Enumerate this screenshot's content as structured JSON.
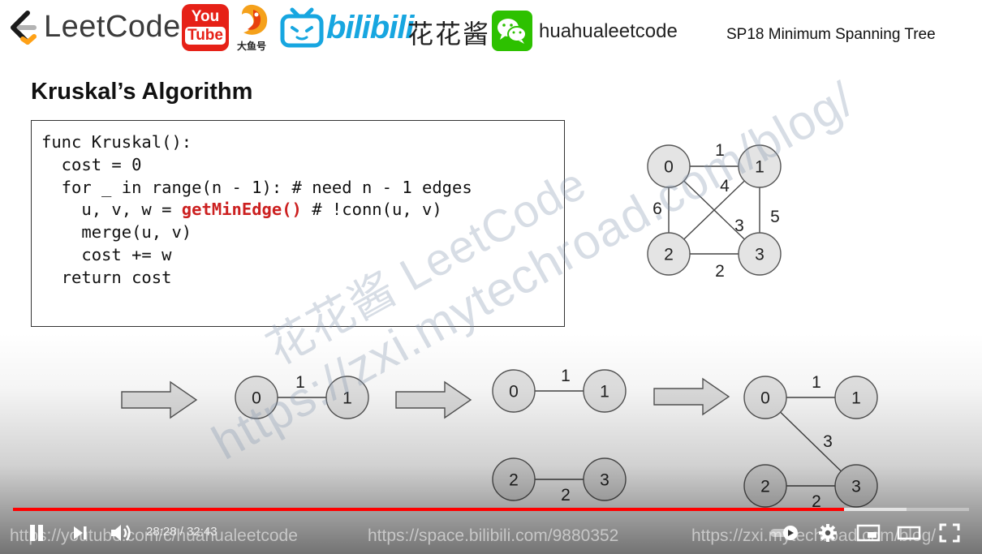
{
  "header": {
    "leetcode_logo_text": "LeetCode",
    "youtube_logo_top": "You",
    "youtube_logo_bottom": "Tube",
    "douyu_caption": "大鱼号",
    "bilibili_logo_text": "bilibili",
    "huahua_text": "花花酱",
    "wechat_handle": "huahualeetcode",
    "series_title": "SP18 Minimum Spanning Tree"
  },
  "slide": {
    "title": "Kruskal’s Algorithm",
    "code_lines": [
      {
        "pre": "func Kruskal():",
        "fn": "",
        "post": ""
      },
      {
        "pre": "  cost = 0",
        "fn": "",
        "post": ""
      },
      {
        "pre": "  for _ in range(n - 1): # need n - 1 edges",
        "fn": "",
        "post": ""
      },
      {
        "pre": "    u, v, w = ",
        "fn": "getMinEdge()",
        "post": " # !conn(u, v)"
      },
      {
        "pre": "    merge(u, v)",
        "fn": "",
        "post": ""
      },
      {
        "pre": "    cost += w",
        "fn": "",
        "post": ""
      },
      {
        "pre": "  return cost",
        "fn": "",
        "post": ""
      }
    ],
    "code_highlight_color": "#cc2020",
    "main_graph": {
      "nodes": [
        "0",
        "1",
        "2",
        "3"
      ],
      "edges": [
        {
          "from": "0",
          "to": "1",
          "weight": "1"
        },
        {
          "from": "1",
          "to": "2",
          "weight": "4"
        },
        {
          "from": "0",
          "to": "2",
          "weight": "6"
        },
        {
          "from": "0",
          "to": "3",
          "weight": "3"
        },
        {
          "from": "1",
          "to": "3",
          "weight": "5"
        },
        {
          "from": "2",
          "to": "3",
          "weight": "2"
        }
      ]
    },
    "steps": [
      {
        "edges": [
          {
            "from": "0",
            "to": "1",
            "weight": "1"
          }
        ]
      },
      {
        "edges": [
          {
            "from": "0",
            "to": "1",
            "weight": "1"
          },
          {
            "from": "2",
            "to": "3",
            "weight": "2"
          }
        ]
      },
      {
        "edges": [
          {
            "from": "0",
            "to": "1",
            "weight": "1"
          },
          {
            "from": "0",
            "to": "3",
            "weight": "3"
          },
          {
            "from": "2",
            "to": "3",
            "weight": "2"
          }
        ]
      }
    ],
    "watermark_text": "花花酱 LeetCode",
    "watermark_url": "https://zxi.mytechroad.com/blog/"
  },
  "footer_urls": {
    "youtube": "https://youtube.com/c/huahualeetcode",
    "bilibili": "https://space.bilibili.com/9880352",
    "blog": "https://zxi.mytechroad.com/blog/"
  },
  "player": {
    "current_time": "28:28",
    "separator": " / ",
    "total_time": "32:43",
    "played_fraction": 0.869,
    "buffered_fraction": 0.935,
    "progress_color": "#ff0000",
    "controls": [
      "pause-icon",
      "next-icon",
      "volume-icon",
      "autoplay-toggle-icon",
      "settings-gear-icon",
      "miniplayer-icon",
      "theater-mode-icon",
      "fullscreen-icon"
    ]
  },
  "colors": {
    "node_fill": "#e4e4e4",
    "node_stroke": "#555555",
    "bilibili_blue": "#17a6e0",
    "wechat_green": "#2dc100",
    "youtube_red": "#e62117"
  }
}
